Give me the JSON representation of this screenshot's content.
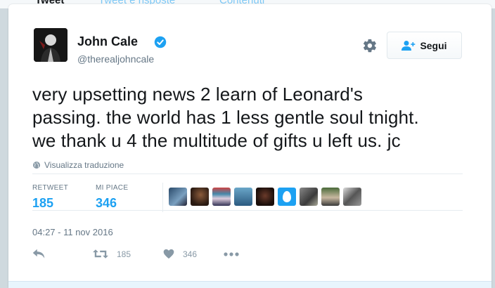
{
  "background_tabs": [
    "Tweet",
    "Tweet e risposte",
    "Contenuti"
  ],
  "author": {
    "name": "John Cale",
    "handle": "@therealjohncale",
    "verified": true
  },
  "follow_button": {
    "label": "Segui",
    "icon": "add-user-icon"
  },
  "settings_icon": "gear-icon",
  "tweet": {
    "text_lines": [
      "very upsetting news 2 learn of Leonard's",
      "passing. the world has 1 less gentle soul tnight.",
      "we thank u 4 the multitude of gifts u left us. jc"
    ],
    "translate_label": "Visualizza traduzione",
    "timestamp": "04:27 - 11 nov 2016"
  },
  "stats": {
    "retweet_label": "RETWEET",
    "retweet_count": "185",
    "likes_label": "MI PIACE",
    "likes_count": "346"
  },
  "likers_count_shown": 9,
  "actions": {
    "reply_icon": "reply-icon",
    "retweet_icon": "retweet-icon",
    "retweet_count": "185",
    "like_icon": "heart-icon",
    "like_count": "346",
    "more_icon": "more-dots-icon"
  },
  "colors": {
    "accent": "#1da1f2",
    "text": "#14171a",
    "muted": "#657786",
    "icon": "#8899a6"
  }
}
